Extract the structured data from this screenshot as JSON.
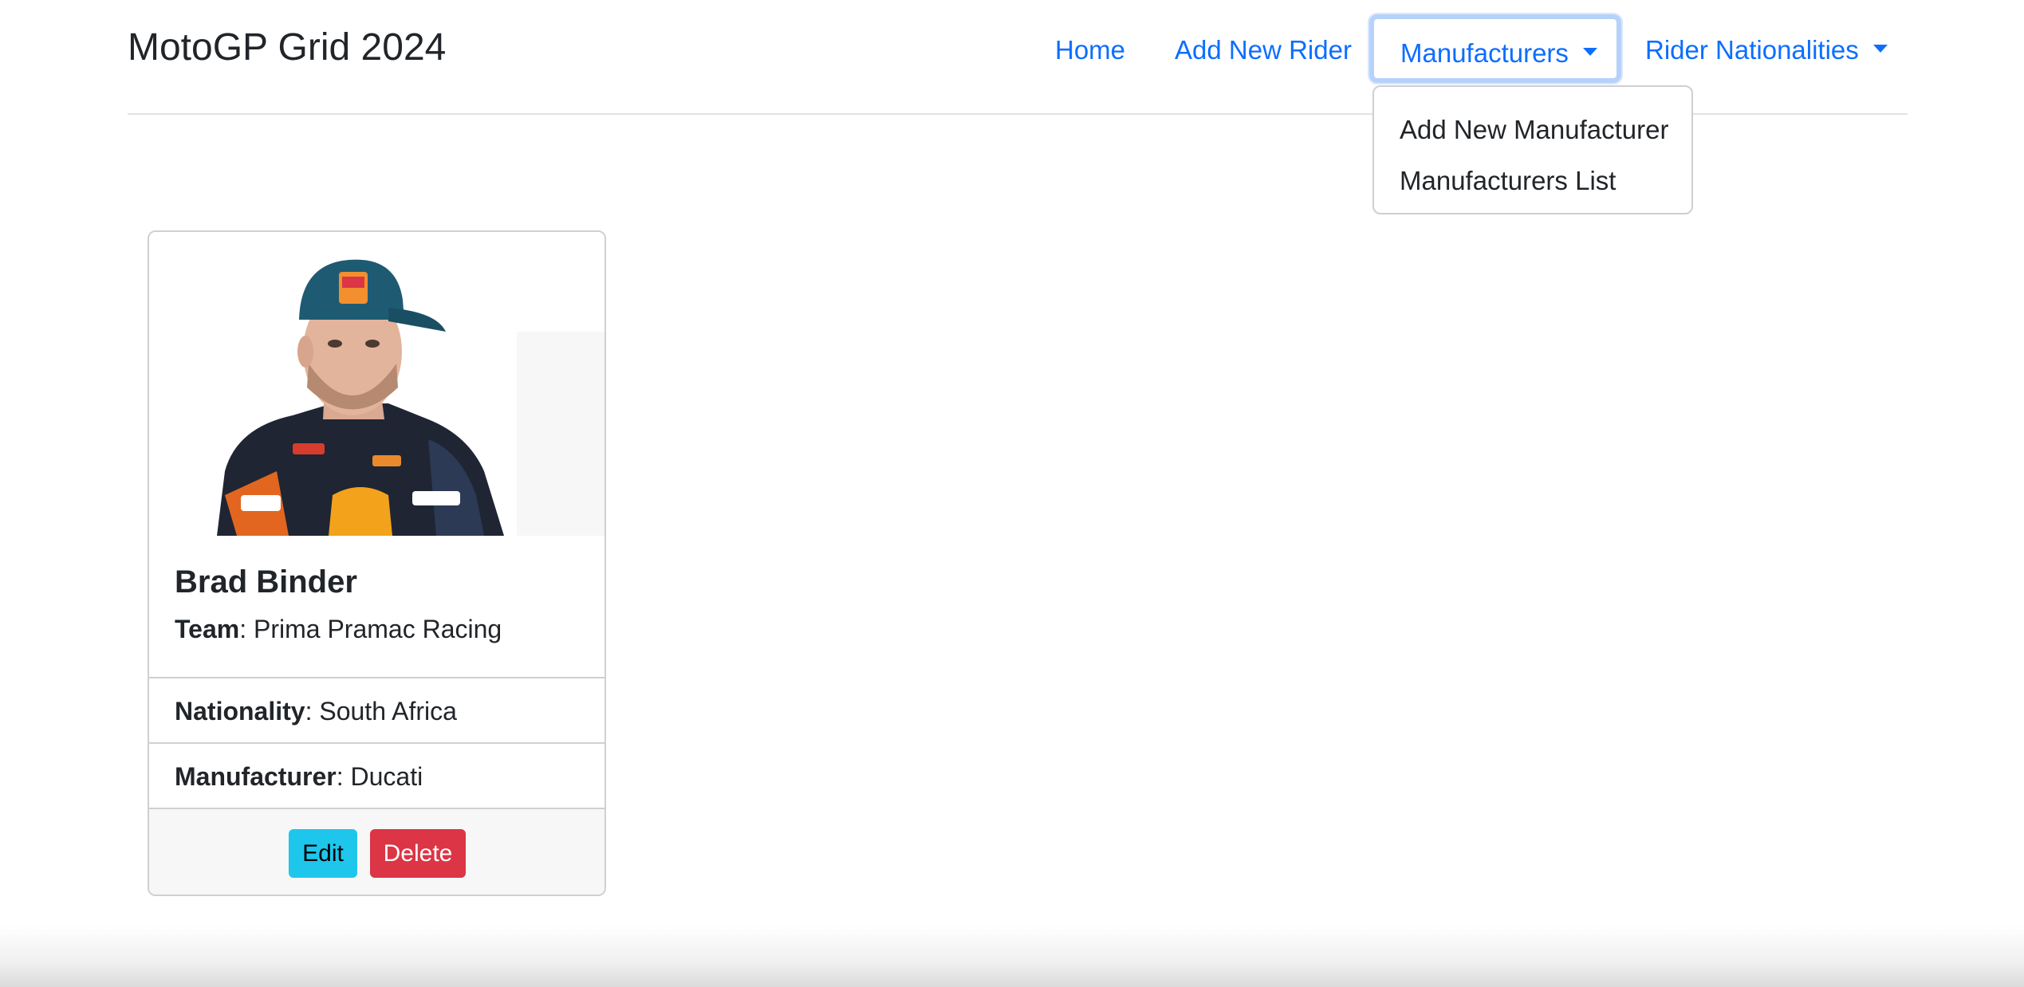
{
  "header": {
    "brand": "MotoGP Grid 2024",
    "nav": {
      "home": "Home",
      "add_rider": "Add New Rider",
      "manufacturers": "Manufacturers",
      "nationalities": "Rider Nationalities"
    }
  },
  "dropdown": {
    "items": [
      "Add New Manufacturer",
      "Manufacturers List"
    ]
  },
  "card": {
    "name": "Brad Binder",
    "team_label": "Team",
    "team": "Prima Pramac Racing",
    "nationality_label": "Nationality",
    "nationality": "South Africa",
    "manufacturer_label": "Manufacturer",
    "manufacturer": "Ducati",
    "edit": "Edit",
    "delete": "Delete"
  },
  "colors": {
    "link": "#0d6efd",
    "edit_button": "#1fc6ec",
    "delete_button": "#dc3545",
    "focus_ring": "#b6d2fb"
  }
}
